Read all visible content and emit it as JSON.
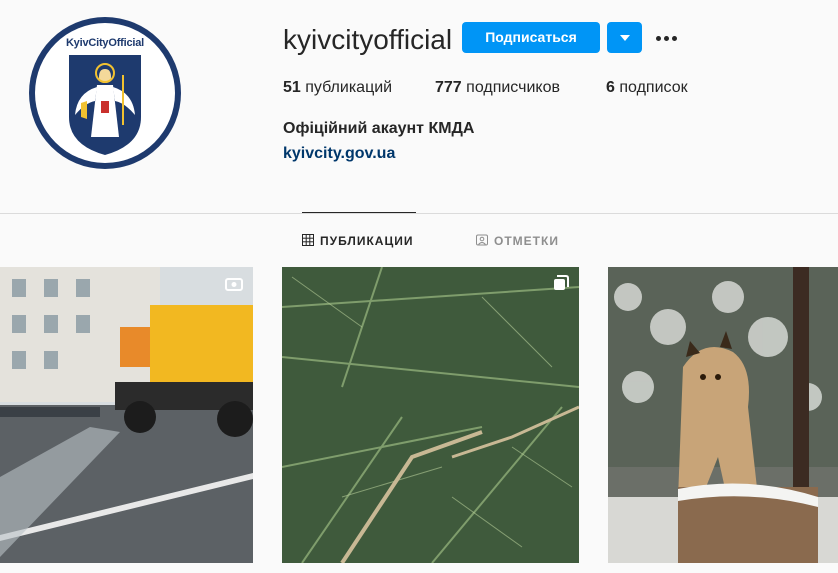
{
  "profile": {
    "avatar_label": "KyivCityOfficial",
    "username": "kyivcityofficial",
    "follow_label": "Подписаться",
    "stats": [
      {
        "count": "51",
        "label": "публикаций"
      },
      {
        "count": "777",
        "label": "подписчиков"
      },
      {
        "count": "6",
        "label": "подписок"
      }
    ],
    "full_name": "Офіційний акаунт КМДА",
    "website": "kyivcity.gov.ua"
  },
  "tabs": [
    {
      "label": "ПУБЛИКАЦИИ",
      "icon": "grid-icon",
      "active": true
    },
    {
      "label": "ОТМЕТКИ",
      "icon": "tagged-icon",
      "active": false
    }
  ],
  "posts": [
    {
      "subject": "street-cleaning-truck",
      "badge": "igtv-icon"
    },
    {
      "subject": "pine-branches",
      "badge": "carousel-icon"
    },
    {
      "subject": "lynx-on-stump",
      "badge": ""
    }
  ],
  "colors": {
    "accent": "#0095f6",
    "link": "#00376b",
    "avatar_ring": "#1e3a6e"
  }
}
